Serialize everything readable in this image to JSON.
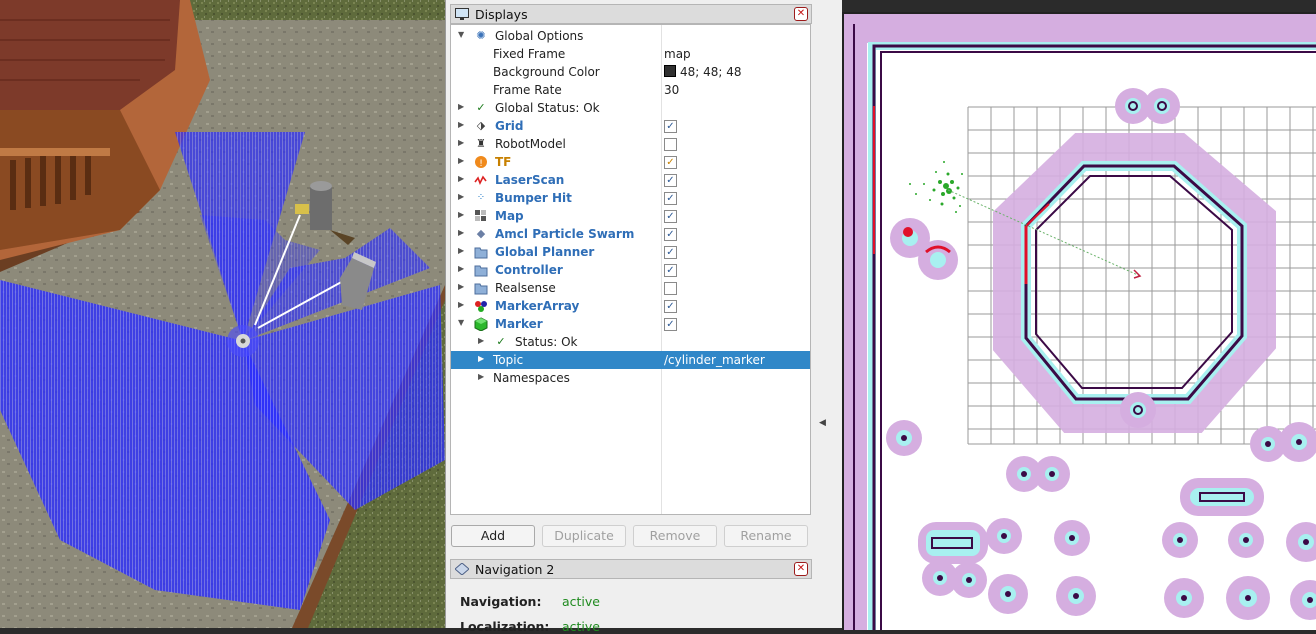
{
  "displays_panel": {
    "title": "Displays",
    "close": "✕",
    "rows": [
      {
        "label": "Global Options",
        "value": ""
      },
      {
        "label": "Fixed Frame",
        "value": "map"
      },
      {
        "label": "Background Color",
        "value": "48; 48; 48"
      },
      {
        "label": "Frame Rate",
        "value": "30"
      },
      {
        "label": "Global Status: Ok",
        "value": ""
      },
      {
        "label": "Grid",
        "checked": true
      },
      {
        "label": "RobotModel",
        "checked": false
      },
      {
        "label": "TF",
        "checked": true
      },
      {
        "label": "LaserScan",
        "checked": true
      },
      {
        "label": "Bumper Hit",
        "checked": true
      },
      {
        "label": "Map",
        "checked": true
      },
      {
        "label": "Amcl Particle Swarm",
        "checked": true
      },
      {
        "label": "Global Planner",
        "checked": true
      },
      {
        "label": "Controller",
        "checked": true
      },
      {
        "label": "Realsense",
        "checked": false
      },
      {
        "label": "MarkerArray",
        "checked": true
      },
      {
        "label": "Marker",
        "checked": true
      },
      {
        "label": "Status: Ok",
        "value": ""
      },
      {
        "label": "Topic",
        "value": "/cylinder_marker"
      },
      {
        "label": "Namespaces",
        "value": ""
      }
    ]
  },
  "buttons": {
    "add": "Add",
    "duplicate": "Duplicate",
    "remove": "Remove",
    "rename": "Rename"
  },
  "navigation_panel": {
    "title": "Navigation 2",
    "close": "✕",
    "navigation_label": "Navigation:",
    "navigation_value": "active",
    "localization_label": "Localization:",
    "localization_value": "active"
  },
  "icons": {
    "global_options": "gear-icon",
    "status_ok": "checkmark-icon",
    "grid": "grid-icon",
    "robot_model": "robot-icon",
    "tf": "tf-icon",
    "laser_scan": "laser-icon",
    "bumper_hit": "dots-icon",
    "map": "map-icon",
    "amcl": "diamond-icon",
    "folder": "folder-icon",
    "marker_array": "balls-icon",
    "marker": "cube-icon",
    "splitter": "splitter-arrow-icon"
  },
  "colors": {
    "selection": "#3087c8",
    "display_name_blue": "#2f6eb7",
    "tf_orange": "#c78000",
    "status_green": "#1f8a1f",
    "laser_blue": "#1f1fff"
  }
}
